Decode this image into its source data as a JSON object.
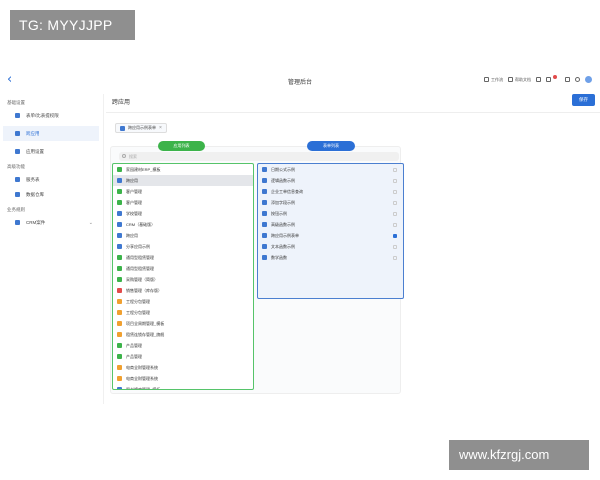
{
  "watermarks": {
    "top": "TG: MYYJJPP",
    "bottom": "www.kfzrgj.com"
  },
  "topbar": {
    "back_glyph": "‹",
    "title": "管理后台",
    "tools": [
      {
        "label": "工作流",
        "icon": "workflow-icon"
      },
      {
        "label": "帮助文档",
        "icon": "help-doc-icon"
      }
    ]
  },
  "sidebar": {
    "sections": [
      {
        "label": "基础设置",
        "items": [
          {
            "label": "表单/比表提权限",
            "icon": "settings-icon"
          },
          {
            "label": "跨应用",
            "icon": "grid-icon",
            "active": true
          },
          {
            "label": "应用设置",
            "icon": "settings-icon"
          }
        ]
      },
      {
        "label": "高级功能",
        "items": [
          {
            "label": "服务表",
            "icon": "grid-icon"
          },
          {
            "label": "数据仓库",
            "icon": "database-icon"
          }
        ]
      },
      {
        "label": "业务规则",
        "items": [
          {
            "label": "CRM案件",
            "icon": "rule-icon",
            "caret": "⌄"
          }
        ]
      }
    ]
  },
  "main": {
    "title": "跨应用",
    "save_label": "保存",
    "chip": {
      "label": "跨应用示例表单",
      "close": "×"
    },
    "search_placeholder": "搜索",
    "left_tag": "应用列表",
    "right_tag": "表单列表",
    "left_list": [
      {
        "label": "家园建材ERP_模板",
        "color": "#3cb34a"
      },
      {
        "label": "跨应用",
        "color": "#3f78d0",
        "selected": true
      },
      {
        "label": "客户管理",
        "color": "#3cb34a"
      },
      {
        "label": "客户管理",
        "color": "#3cb34a"
      },
      {
        "label": "学校管理",
        "color": "#3f78d0"
      },
      {
        "label": "CRM（基础版）",
        "color": "#3f78d0"
      },
      {
        "label": "跨应用",
        "color": "#3f78d0"
      },
      {
        "label": "分享应用示例",
        "color": "#3f78d0"
      },
      {
        "label": "通用型租赁管理",
        "color": "#3cb34a"
      },
      {
        "label": "通用型租赁管理",
        "color": "#3cb34a"
      },
      {
        "label": "采购管理（简版）",
        "color": "#3cb34a"
      },
      {
        "label": "销售管理（库存版）",
        "color": "#e24b4b"
      },
      {
        "label": "工程分包管理",
        "color": "#f0a030"
      },
      {
        "label": "工程分包管理",
        "color": "#f0a030"
      },
      {
        "label": "项目全周期管理_模板",
        "color": "#f0a030"
      },
      {
        "label": "租赁连锁存管理_旗舰",
        "color": "#f0a030"
      },
      {
        "label": "产品管理",
        "color": "#3cb34a"
      },
      {
        "label": "产品管理",
        "color": "#3cb34a"
      },
      {
        "label": "电商全财管理系统",
        "color": "#f0a030"
      },
      {
        "label": "电商全财管理系统",
        "color": "#f0a030"
      },
      {
        "label": "图书馆库管理_模板",
        "color": "#3f78d0"
      }
    ],
    "right_list": [
      {
        "label": "日期公式示例",
        "checked": false
      },
      {
        "label": "逻辑函数示例",
        "checked": false
      },
      {
        "label": "企业工单信息查询",
        "checked": false
      },
      {
        "label": "添加字段示例",
        "checked": false
      },
      {
        "label": "按钮示例",
        "checked": false
      },
      {
        "label": "高级函数示例",
        "checked": false
      },
      {
        "label": "跨应用示例表单",
        "checked": true
      },
      {
        "label": "文本函数示例",
        "checked": false
      },
      {
        "label": "数学函数",
        "checked": false
      }
    ]
  }
}
